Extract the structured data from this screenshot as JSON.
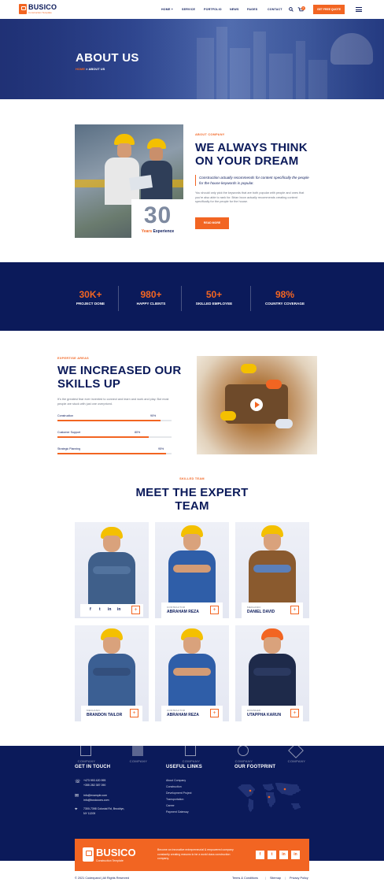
{
  "header": {
    "logo": "BUSICO",
    "logo_sub": "Construction Template",
    "nav": [
      "HOME +",
      "SERVICE",
      "PORTFOLIO",
      "NEWS",
      "PAGES",
      "CONTACT"
    ],
    "cart_count": "0",
    "quote_btn": "GET FREE QUOTE"
  },
  "hero": {
    "title": "ABOUT US",
    "breadcrumb_home": "HOME",
    "breadcrumb_sep": ">",
    "breadcrumb_current": "ABOUT US"
  },
  "about": {
    "tag": "ABOUT COMPANY",
    "heading_line1": "WE ALWAYS THINK",
    "heading_line2": "ON YOUR DREAM",
    "quote": "Construction actually recommends for content specifically the people for the house keywords is popular.",
    "body": "You should only pick the keywords that are both popular with people and ones that you're also able to rank for. Brian boon actually recommends creating content specifically for the people for the house.",
    "button": "READ MORE",
    "years_num": "30",
    "years_label_a": "Years",
    "years_label_b": "Experience"
  },
  "stats": [
    {
      "value": "30K+",
      "label": "PROJECT DONE"
    },
    {
      "value": "980+",
      "label": "HAPPY CLIENTS"
    },
    {
      "value": "50+",
      "label": "SKILLED EMPLOYEE"
    },
    {
      "value": "98%",
      "label": "COUNTRY COVERAGE"
    }
  ],
  "skills": {
    "tag": "EXPERTISE AREAS",
    "heading_line1": "WE INCREASED OUR",
    "heading_line2": "SKILLS UP",
    "body": "It's the greatest fear ever invented to connect and learn and work and play. But most people are stuck with just one overpriced.",
    "bars": [
      {
        "label": "Construction",
        "percent_text": "90%",
        "value": 0.9
      },
      {
        "label": "Customer Support",
        "percent_text": "80%",
        "value": 0.8
      },
      {
        "label": "Strategic Planning",
        "percent_text": "95%",
        "value": 0.95
      }
    ]
  },
  "team": {
    "tag": "SKILLED TEAM",
    "heading_line1": "MEET THE EXPERT",
    "heading_line2": "TEAM",
    "members": [
      {
        "role": "",
        "name": ""
      },
      {
        "role": "CONTRACTOR",
        "name": "ABRAHAM REZA"
      },
      {
        "role": "MECHANIC",
        "name": "DANIEL DAVID"
      },
      {
        "role": "MECHANIC",
        "name": "BRANDON TAILOR"
      },
      {
        "role": "CONTRACTOR",
        "name": "ABRAHAM REZA"
      },
      {
        "role": "ENGINEER",
        "name": "UTAPPHA KARUN"
      }
    ],
    "social": [
      "f",
      "t",
      "in",
      "in"
    ]
  },
  "footer": {
    "brands": [
      "COMPANY",
      "COMPANY",
      "COMPANY",
      "COMPANY",
      "COMPANY",
      "COMPANY"
    ],
    "touch_head": "GET IN TOUCH",
    "phone1": "+473 993 420 995",
    "phone2": "+355 282 387 090",
    "email1": "info@example.com",
    "email2": "info@busicoons.com",
    "address1": "7300-7398 Colonial Rd, Brooklyn,",
    "address2": "NY 11209",
    "links_head": "USEFUL LINKS",
    "links": [
      "About Company",
      "Construction",
      "Development Project",
      "Transportation",
      "Career",
      "Payment Gateway"
    ],
    "footprint_head": "OUR FOOTPRINT",
    "cta_name": "BUSICO",
    "cta_sub": "Construction Template",
    "cta_text": "Become an innovative entrepreneurial & empowered company constantly creating reasons to be a world class construction company.",
    "cta_social": [
      "f",
      "t",
      "in",
      "in"
    ],
    "copyright": "© 2021 Codexpand  |  All Rights Reserved",
    "bottom_links": [
      "Terms & Conditions",
      "Sitemap",
      "Privacy Policy"
    ]
  }
}
